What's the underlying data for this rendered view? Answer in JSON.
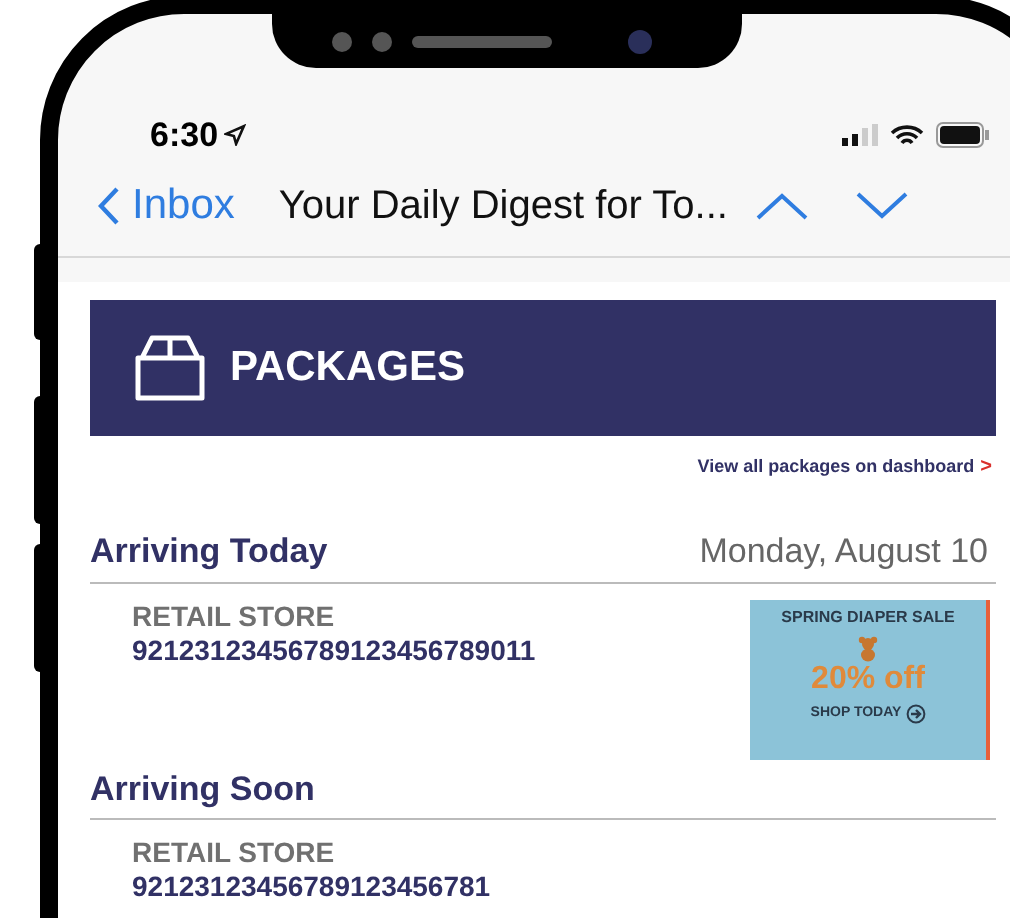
{
  "status_bar": {
    "time": "6:30"
  },
  "nav": {
    "back_label": "Inbox",
    "title": "Your Daily Digest for To..."
  },
  "banner": {
    "title": "PACKAGES"
  },
  "dashboard_link": {
    "label": "View all packages on dashboard",
    "arrow": ">"
  },
  "sections": [
    {
      "heading": "Arriving Today",
      "date": "Monday, August 10",
      "packages": [
        {
          "store": "RETAIL STORE",
          "tracking": "92123123456789123456789011"
        }
      ],
      "ad": {
        "headline": "SPRING DIAPER SALE",
        "offer": "20% off",
        "cta": "SHOP TODAY"
      }
    },
    {
      "heading": "Arriving Soon",
      "packages": [
        {
          "store": "RETAIL STORE",
          "tracking": "92123123456789123456781"
        }
      ]
    }
  ]
}
